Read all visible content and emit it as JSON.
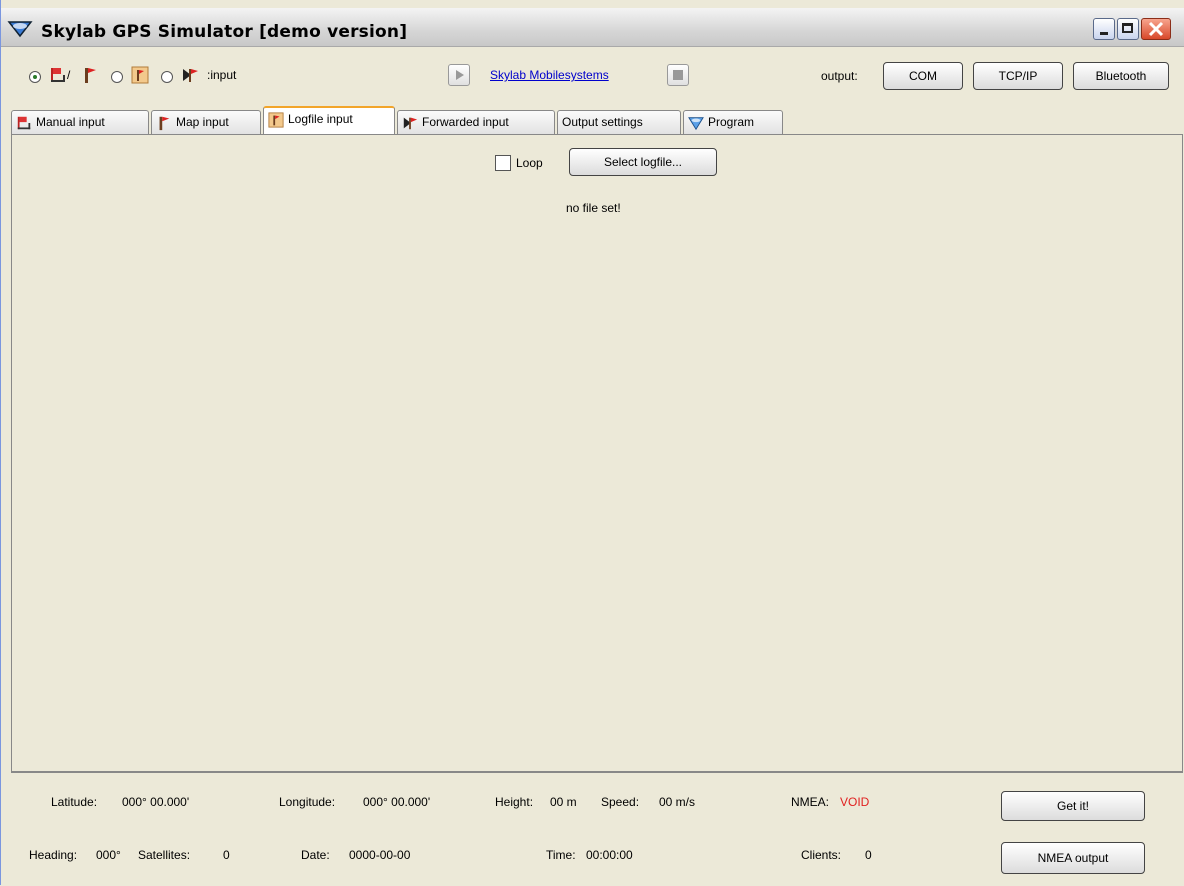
{
  "window": {
    "title": "Skylab GPS Simulator [demo version]"
  },
  "toolbar": {
    "input_suffix": ":input",
    "link": "Skylab Mobilesystems",
    "output_label": "output:",
    "buttons": [
      "COM",
      "TCP/IP",
      "Bluetooth"
    ],
    "selected_input": "manual"
  },
  "tabs": [
    "Manual input",
    "Map input",
    "Logfile input",
    "Forwarded input",
    "Output settings",
    "Program"
  ],
  "active_tab": "Logfile input",
  "logfile": {
    "loop_label": "Loop",
    "loop_checked": false,
    "select_button": "Select logfile...",
    "status": "no file set!"
  },
  "status": {
    "latitude_label": "Latitude:",
    "latitude": "000° 00.000'",
    "longitude_label": "Longitude:",
    "longitude": "000° 00.000'",
    "height_label": "Height:",
    "height": "00 m",
    "speed_label": "Speed:",
    "speed": "00 m/s",
    "nmea_label": "NMEA:",
    "nmea": "VOID",
    "heading_label": "Heading:",
    "heading": "000°",
    "satellites_label": "Satellites:",
    "satellites": "0",
    "date_label": "Date:",
    "date": "0000-00-00",
    "time_label": "Time:",
    "time": "00:00:00",
    "clients_label": "Clients:",
    "clients": "0",
    "get_it_button": "Get it!",
    "nmea_output_button": "NMEA output"
  },
  "colors": {
    "nmea_void": "#e02020",
    "active_tab_accent": "#f2a52a",
    "link": "#0000cc"
  }
}
